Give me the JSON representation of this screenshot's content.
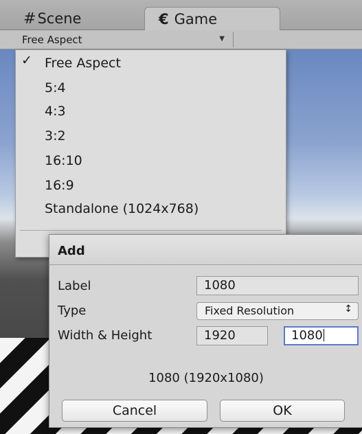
{
  "tabs": [
    {
      "label": "Scene",
      "icon": "#"
    },
    {
      "label": "Game",
      "icon": "€"
    }
  ],
  "toolbar": {
    "aspect_value": "Free Aspect"
  },
  "menu": {
    "checkmark": "✓",
    "items": [
      "Free Aspect",
      "5:4",
      "4:3",
      "3:2",
      "16:10",
      "16:9",
      "Standalone (1024x768)"
    ],
    "selected_index": 0
  },
  "dialog": {
    "title": "Add",
    "label_caption": "Label",
    "label_value": "1080",
    "type_caption": "Type",
    "type_value": "Fixed Resolution",
    "type_arrows": "↕",
    "wh_caption": "Width & Height",
    "width_value": "1920",
    "height_value": "1080",
    "preview": "1080 (1920x1080)",
    "cancel_label": "Cancel",
    "ok_label": "OK"
  },
  "colors": {
    "accent_focus": "#5b76d6",
    "panel": "#d6d6d6",
    "menu": "#dddddd"
  }
}
